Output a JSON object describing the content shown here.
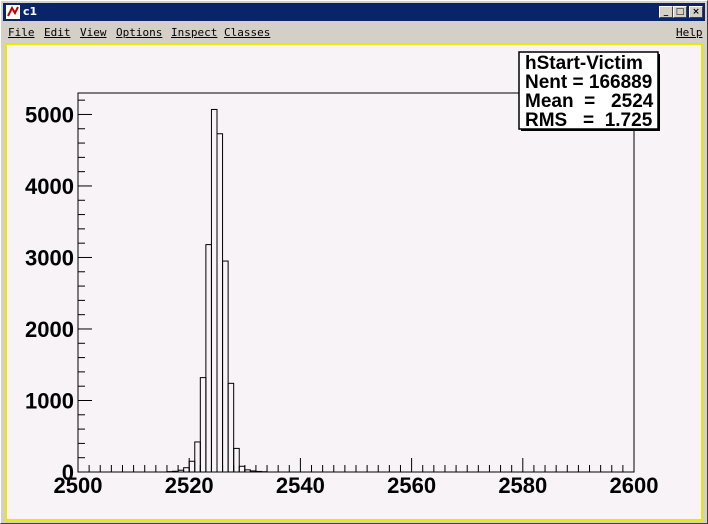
{
  "window": {
    "title": "c1"
  },
  "menu": {
    "items": [
      "File",
      "Edit",
      "View",
      "Options",
      "Inspect",
      "Classes"
    ],
    "help": "Help"
  },
  "stats": {
    "name": "hStart-Victim",
    "entries_line": "Nent = 166889",
    "mean_line": "Mean  =   2524",
    "rms_line": "RMS   =  1.725"
  },
  "chart_data": {
    "type": "histogram",
    "title": "",
    "xlabel": "",
    "ylabel": "",
    "xlim": [
      2500,
      2600
    ],
    "ylim": [
      0,
      5300
    ],
    "bin_width": 1,
    "x_ticks": [
      2500,
      2520,
      2540,
      2560,
      2580,
      2600
    ],
    "y_ticks": [
      0,
      1000,
      2000,
      3000,
      4000,
      5000
    ],
    "bins": [
      {
        "x": 2516,
        "count": 5
      },
      {
        "x": 2517,
        "count": 10
      },
      {
        "x": 2518,
        "count": 25
      },
      {
        "x": 2519,
        "count": 60
      },
      {
        "x": 2520,
        "count": 150
      },
      {
        "x": 2521,
        "count": 420
      },
      {
        "x": 2522,
        "count": 1320
      },
      {
        "x": 2523,
        "count": 3180
      },
      {
        "x": 2524,
        "count": 5070
      },
      {
        "x": 2525,
        "count": 4730
      },
      {
        "x": 2526,
        "count": 2950
      },
      {
        "x": 2527,
        "count": 1240
      },
      {
        "x": 2528,
        "count": 330
      },
      {
        "x": 2529,
        "count": 80
      },
      {
        "x": 2530,
        "count": 30
      },
      {
        "x": 2531,
        "count": 15
      },
      {
        "x": 2532,
        "count": 8
      },
      {
        "x": 2533,
        "count": 4
      }
    ],
    "grid": false,
    "legend": "top-right"
  }
}
